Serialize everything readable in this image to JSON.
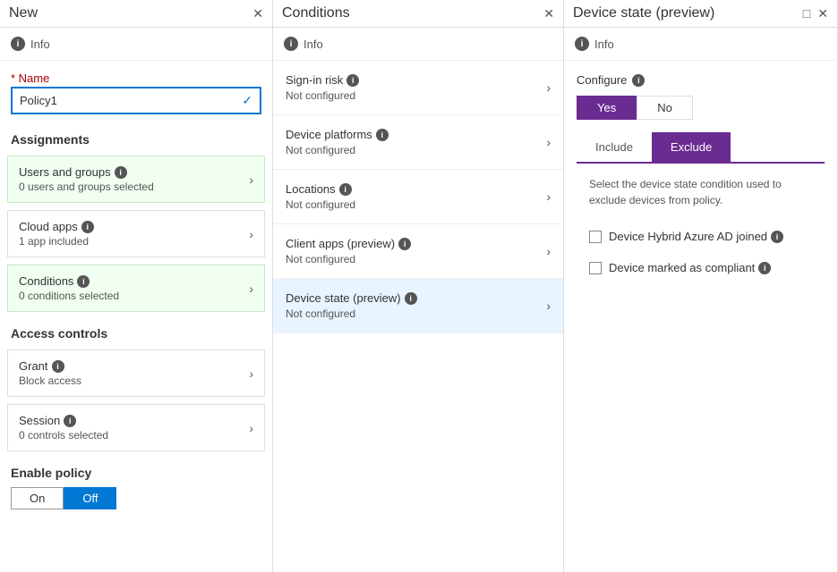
{
  "left_panel": {
    "title": "New",
    "info_text": "Info",
    "name_label": "Name",
    "name_value": "Policy1",
    "assignments_label": "Assignments",
    "users_groups": {
      "title": "Users and groups",
      "sub": "0 users and groups selected"
    },
    "cloud_apps": {
      "title": "Cloud apps",
      "sub": "1 app included"
    },
    "conditions": {
      "title": "Conditions",
      "sub": "0 conditions selected"
    },
    "access_controls_label": "Access controls",
    "grant": {
      "title": "Grant",
      "sub": "Block access"
    },
    "session": {
      "title": "Session",
      "sub": "0 controls selected"
    },
    "enable_policy_label": "Enable policy",
    "toggle_on": "On",
    "toggle_off": "Off"
  },
  "middle_panel": {
    "title": "Conditions",
    "info_text": "Info",
    "conditions": [
      {
        "title": "Sign-in risk",
        "sub": "Not configured"
      },
      {
        "title": "Device platforms",
        "sub": "Not configured"
      },
      {
        "title": "Locations",
        "sub": "Not configured"
      },
      {
        "title": "Client apps (preview)",
        "sub": "Not configured"
      },
      {
        "title": "Device state (preview)",
        "sub": "Not configured",
        "active": true
      }
    ]
  },
  "right_panel": {
    "title": "Device state (preview)",
    "info_text": "Info",
    "configure_label": "Configure",
    "yes_label": "Yes",
    "no_label": "No",
    "tab_include": "Include",
    "tab_exclude": "Exclude",
    "description": "Select the device state condition used to exclude devices from policy.",
    "checkboxes": [
      {
        "label": "Device Hybrid Azure AD joined"
      },
      {
        "label": "Device marked as compliant"
      }
    ]
  }
}
